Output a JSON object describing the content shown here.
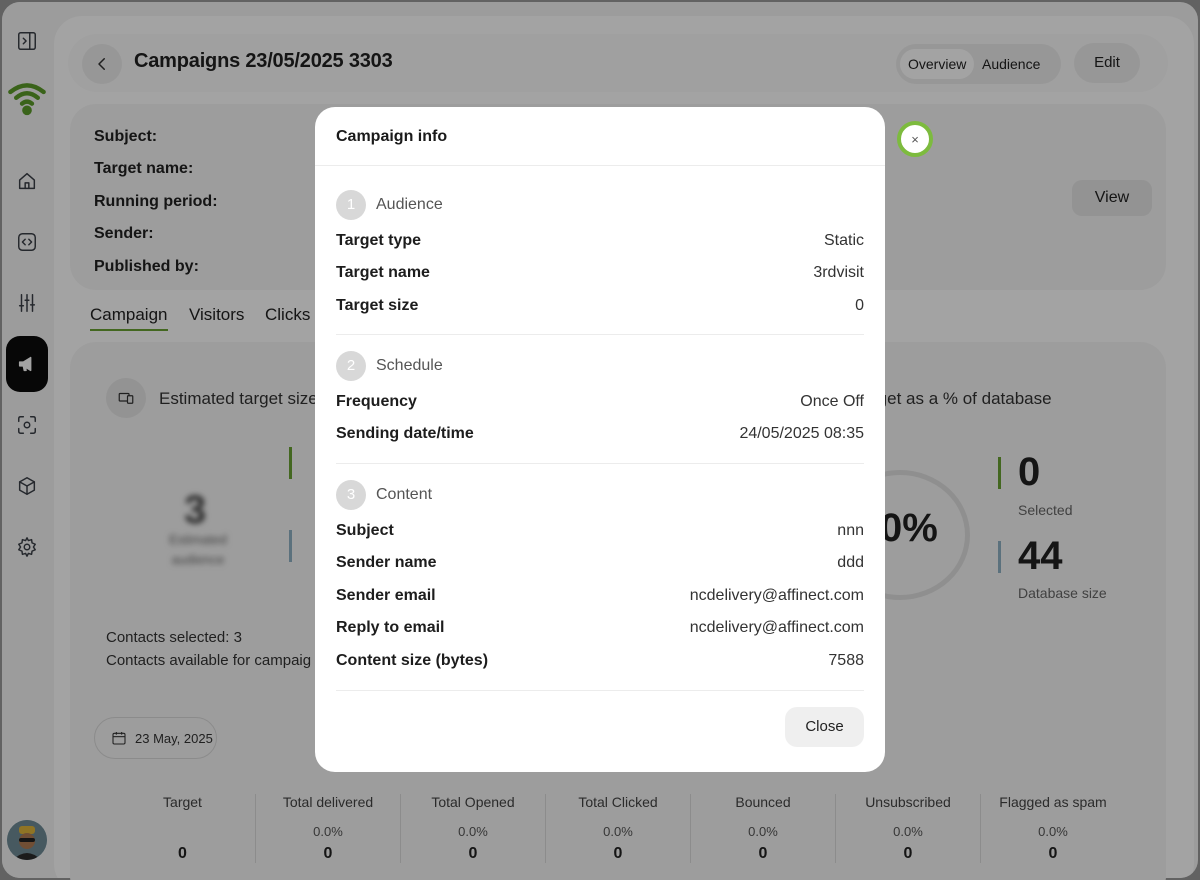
{
  "header": {
    "title": "Campaigns 23/05/2025 3303",
    "tabs": [
      "Overview",
      "Audience"
    ],
    "edit_label": "Edit"
  },
  "info_card": {
    "labels": [
      "Subject:",
      "Target name:",
      "Running period:",
      "Sender:",
      "Published by:"
    ],
    "view_label": "View"
  },
  "subtabs": [
    "Campaign",
    "Visitors",
    "Clicks"
  ],
  "content": {
    "estimated_label": "Estimated target size",
    "percent_label": "rget as a % of database",
    "estimated_value": "3",
    "estimated_sub": "Estimated audience",
    "donut_text": "0%",
    "selected_value": "0",
    "selected_label": "Selected",
    "db_value": "44",
    "db_label": "Database size",
    "contacts_selected": "Contacts selected: 3",
    "contacts_available": "Contacts available for campaig",
    "date_chip": "23 May, 2025",
    "accent_green": "#6aa233",
    "accent_blue": "#8fb1c4"
  },
  "stats": [
    {
      "label": "Target",
      "pct": "",
      "value": "0"
    },
    {
      "label": "Total delivered",
      "pct": "0.0%",
      "value": "0"
    },
    {
      "label": "Total Opened",
      "pct": "0.0%",
      "value": "0"
    },
    {
      "label": "Total Clicked",
      "pct": "0.0%",
      "value": "0"
    },
    {
      "label": "Bounced",
      "pct": "0.0%",
      "value": "0"
    },
    {
      "label": "Unsubscribed",
      "pct": "0.0%",
      "value": "0"
    },
    {
      "label": "Flagged as spam",
      "pct": "0.0%",
      "value": "0"
    }
  ],
  "modal": {
    "title": "Campaign info",
    "close_label": "Close",
    "x_label": "×",
    "sections": [
      {
        "num": "1",
        "title": "Audience",
        "rows": [
          {
            "k": "Target type",
            "v": "Static"
          },
          {
            "k": "Target name",
            "v": "3rdvisit"
          },
          {
            "k": "Target size",
            "v": "0"
          }
        ]
      },
      {
        "num": "2",
        "title": "Schedule",
        "rows": [
          {
            "k": "Frequency",
            "v": "Once Off"
          },
          {
            "k": "Sending date/time",
            "v": "24/05/2025 08:35"
          }
        ]
      },
      {
        "num": "3",
        "title": "Content",
        "rows": [
          {
            "k": "Subject",
            "v": "nnn"
          },
          {
            "k": "Sender name",
            "v": "ddd"
          },
          {
            "k": "Sender email",
            "v": "ncdelivery@affinect.com"
          },
          {
            "k": "Reply to email",
            "v": "ncdelivery@affinect.com"
          },
          {
            "k": "Content size (bytes)",
            "v": "7588"
          }
        ]
      }
    ]
  }
}
